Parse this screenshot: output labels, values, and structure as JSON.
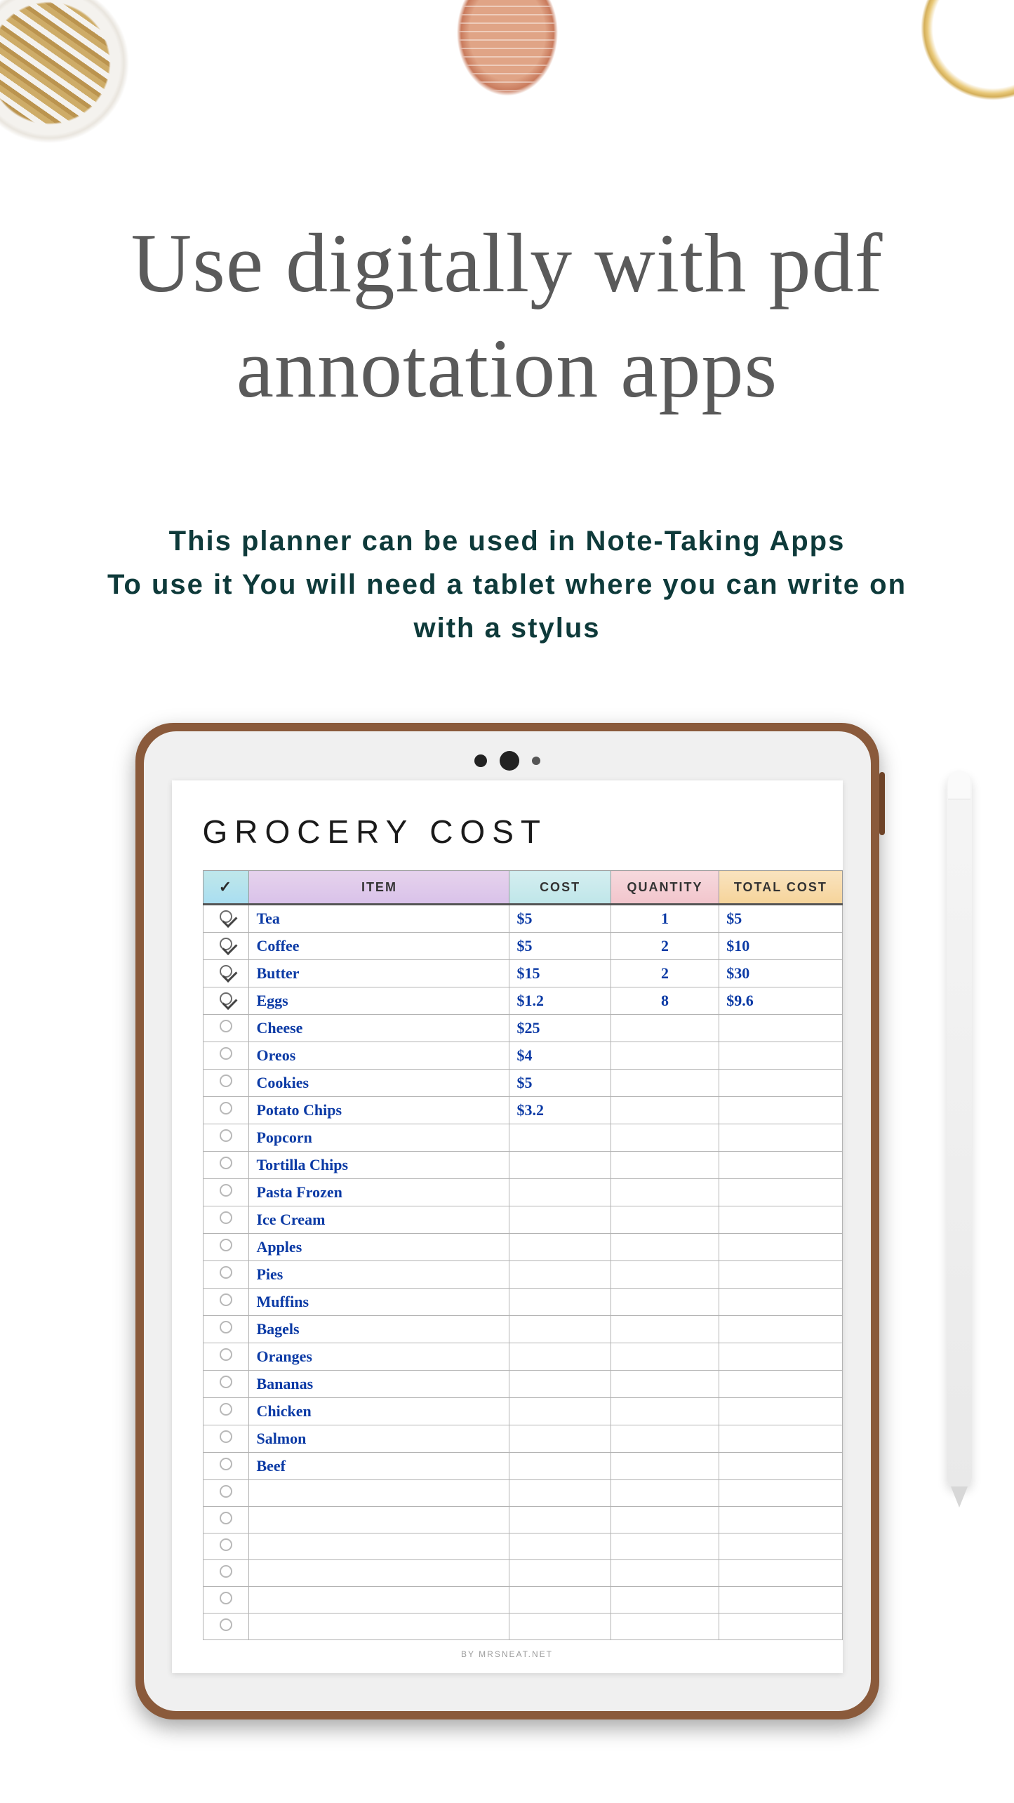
{
  "headline": {
    "line1": "Use digitally with pdf",
    "line2": "annotation apps"
  },
  "subhead": {
    "line1": "This planner can be used in Note-Taking Apps",
    "line2": "To use it You will need a tablet where you can write on",
    "line3": "with a stylus"
  },
  "planner": {
    "title_bold": "GROCERY",
    "title_thin": "COST",
    "headers": {
      "check_symbol": "✓",
      "item": "ITEM",
      "cost": "COST",
      "quantity": "QUANTITY",
      "total": "TOTAL COST"
    },
    "rows": [
      {
        "checked": true,
        "item": "Tea",
        "cost": "$5",
        "qty": "1",
        "total": "$5"
      },
      {
        "checked": true,
        "item": "Coffee",
        "cost": "$5",
        "qty": "2",
        "total": "$10"
      },
      {
        "checked": true,
        "item": "Butter",
        "cost": "$15",
        "qty": "2",
        "total": "$30"
      },
      {
        "checked": true,
        "item": "Eggs",
        "cost": "$1.2",
        "qty": "8",
        "total": "$9.6"
      },
      {
        "checked": false,
        "item": "Cheese",
        "cost": "$25",
        "qty": "",
        "total": ""
      },
      {
        "checked": false,
        "item": "Oreos",
        "cost": "$4",
        "qty": "",
        "total": ""
      },
      {
        "checked": false,
        "item": "Cookies",
        "cost": "$5",
        "qty": "",
        "total": ""
      },
      {
        "checked": false,
        "item": "Potato Chips",
        "cost": "$3.2",
        "qty": "",
        "total": ""
      },
      {
        "checked": false,
        "item": "Popcorn",
        "cost": "",
        "qty": "",
        "total": ""
      },
      {
        "checked": false,
        "item": "Tortilla Chips",
        "cost": "",
        "qty": "",
        "total": ""
      },
      {
        "checked": false,
        "item": "Pasta Frozen",
        "cost": "",
        "qty": "",
        "total": ""
      },
      {
        "checked": false,
        "item": "Ice Cream",
        "cost": "",
        "qty": "",
        "total": ""
      },
      {
        "checked": false,
        "item": "Apples",
        "cost": "",
        "qty": "",
        "total": ""
      },
      {
        "checked": false,
        "item": "Pies",
        "cost": "",
        "qty": "",
        "total": ""
      },
      {
        "checked": false,
        "item": "Muffins",
        "cost": "",
        "qty": "",
        "total": ""
      },
      {
        "checked": false,
        "item": "Bagels",
        "cost": "",
        "qty": "",
        "total": ""
      },
      {
        "checked": false,
        "item": "Oranges",
        "cost": "",
        "qty": "",
        "total": ""
      },
      {
        "checked": false,
        "item": "Bananas",
        "cost": "",
        "qty": "",
        "total": ""
      },
      {
        "checked": false,
        "item": "Chicken",
        "cost": "",
        "qty": "",
        "total": ""
      },
      {
        "checked": false,
        "item": "Salmon",
        "cost": "",
        "qty": "",
        "total": ""
      },
      {
        "checked": false,
        "item": "Beef",
        "cost": "",
        "qty": "",
        "total": ""
      },
      {
        "checked": false,
        "item": "",
        "cost": "",
        "qty": "",
        "total": ""
      },
      {
        "checked": false,
        "item": "",
        "cost": "",
        "qty": "",
        "total": ""
      },
      {
        "checked": false,
        "item": "",
        "cost": "",
        "qty": "",
        "total": ""
      },
      {
        "checked": false,
        "item": "",
        "cost": "",
        "qty": "",
        "total": ""
      },
      {
        "checked": false,
        "item": "",
        "cost": "",
        "qty": "",
        "total": ""
      },
      {
        "checked": false,
        "item": "",
        "cost": "",
        "qty": "",
        "total": ""
      }
    ],
    "footer": "BY MRSNEAT.NET"
  }
}
